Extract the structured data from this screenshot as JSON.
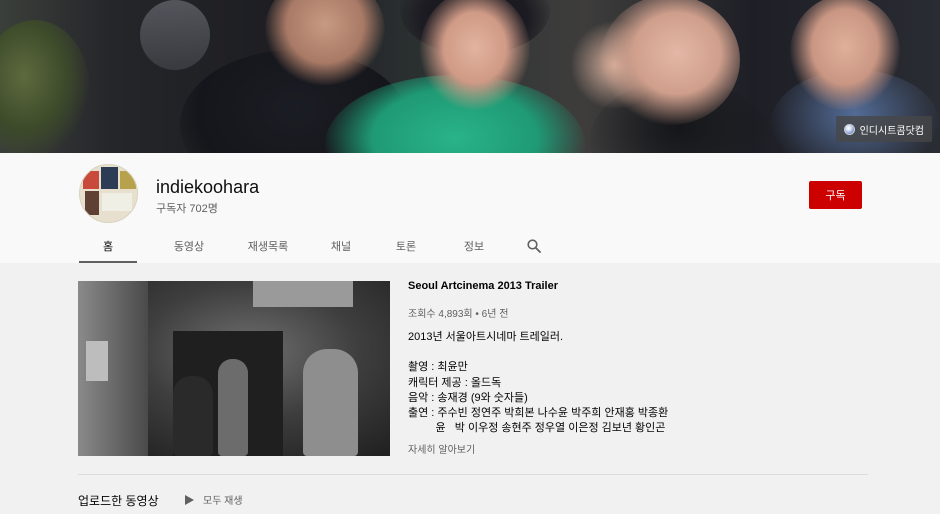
{
  "banner": {
    "link_label": "인디시트콤닷컴",
    "link_icon": "globe-icon"
  },
  "channel": {
    "name": "indiekoohara",
    "subscribers": "구독자 702명",
    "subscribe_label": "구독",
    "subscribe_color": "#cc0000"
  },
  "tabs": [
    {
      "label": "홈",
      "active": true
    },
    {
      "label": "동영상"
    },
    {
      "label": "재생목록"
    },
    {
      "label": "채널"
    },
    {
      "label": "토론"
    },
    {
      "label": "정보"
    }
  ],
  "search_icon": "search-icon",
  "featured": {
    "title": "Seoul Artcinema 2013 Trailer",
    "meta": "조회수 4,893회 • 6년 전",
    "description": "2013년 서울아트시네마 트레일러.\n\n촬영 : 최윤만\n캐릭터 제공 : 올드독\n음악 : 송재경 (9와 숫자들)\n출연 : 주수빈 정연주 박희본 나수윤 박주희 안재홍 박종환\n         윤   박 이우정 송현주 정우열 이은정 김보년 황인곤",
    "more_label": "자세히 알아보기"
  },
  "uploads": {
    "title": "업로드한 동영상",
    "play_all_label": "모두 재생"
  }
}
